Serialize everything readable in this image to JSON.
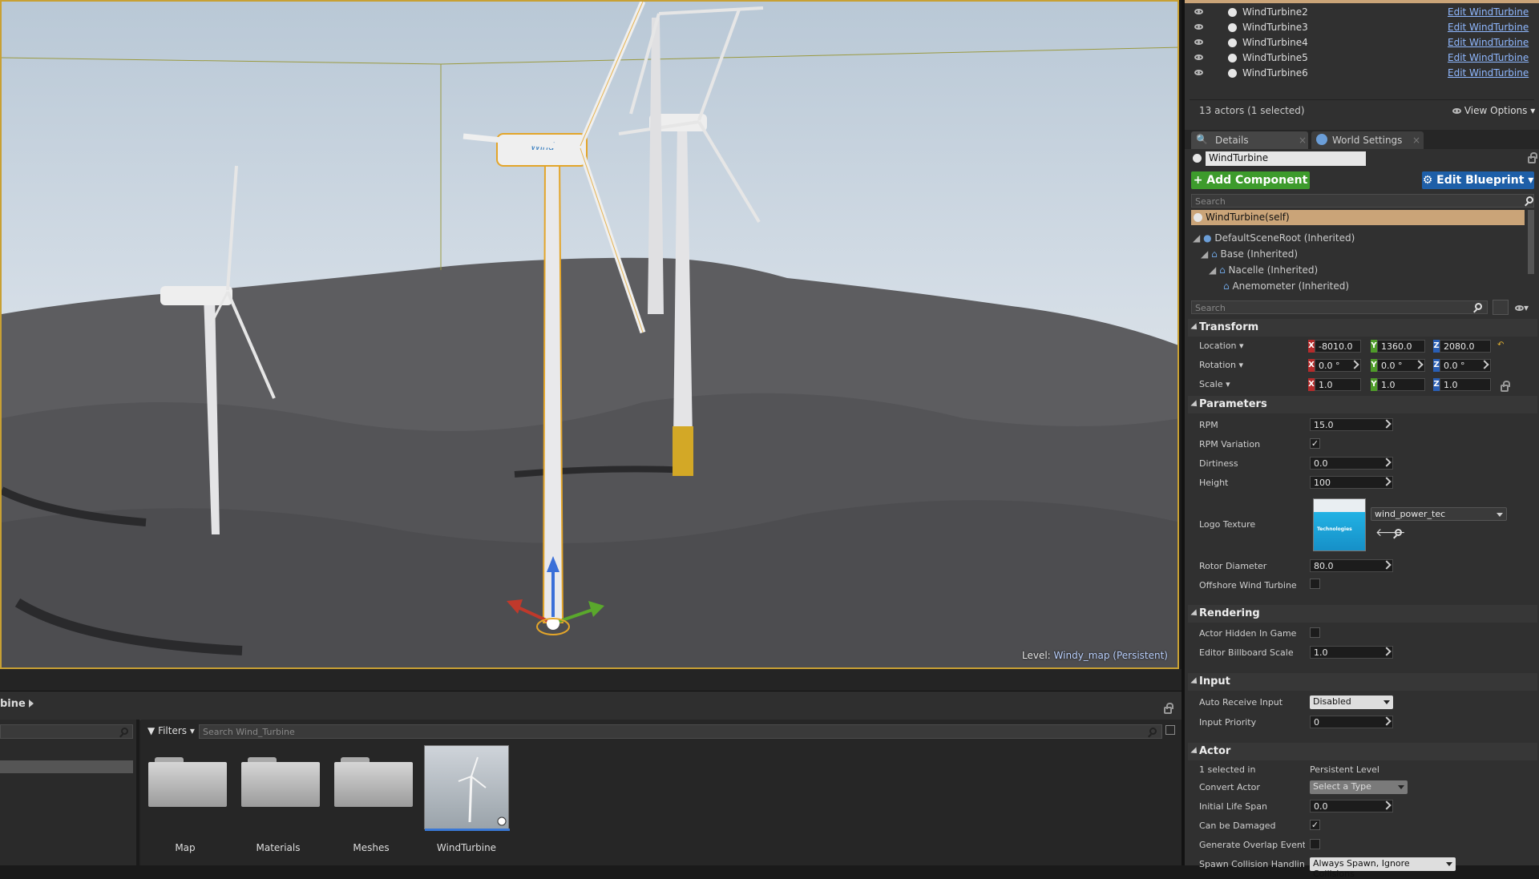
{
  "viewport": {
    "level_prefix": "Level:",
    "level_name": "Windy_map (Persistent)"
  },
  "content_browser": {
    "breadcrumb": "bine",
    "filters_label": "Filters",
    "search_placeholder": "Search Wind_Turbine",
    "assets": [
      {
        "label": "Map",
        "type": "folder"
      },
      {
        "label": "Materials",
        "type": "folder"
      },
      {
        "label": "Meshes",
        "type": "folder"
      },
      {
        "label": "WindTurbine",
        "type": "blueprint"
      }
    ]
  },
  "outliner": {
    "rows": [
      {
        "name": "WindTurbine2",
        "action": "Edit WindTurbine"
      },
      {
        "name": "WindTurbine3",
        "action": "Edit WindTurbine"
      },
      {
        "name": "WindTurbine4",
        "action": "Edit WindTurbine"
      },
      {
        "name": "WindTurbine5",
        "action": "Edit WindTurbine"
      },
      {
        "name": "WindTurbine6",
        "action": "Edit WindTurbine"
      }
    ],
    "actor_count": "13 actors (1 selected)",
    "view_options": "View Options"
  },
  "details": {
    "tabs": [
      "Details",
      "World Settings"
    ],
    "actor_name": "WindTurbine",
    "add_component": "+ Add Component",
    "edit_blueprint": "Edit Blueprint",
    "search_placeholder": "Search",
    "components": [
      "WindTurbine(self)",
      "DefaultSceneRoot (Inherited)",
      "Base (Inherited)",
      "Nacelle (Inherited)",
      "Anemometer (Inherited)"
    ],
    "search2_placeholder": "Search",
    "transform": {
      "title": "Transform",
      "location_label": "Location",
      "location": [
        "-8010.0",
        "1360.0",
        "2080.0"
      ],
      "rotation_label": "Rotation",
      "rotation": [
        "0.0 °",
        "0.0 °",
        "0.0 °"
      ],
      "scale_label": "Scale",
      "scale": [
        "1.0",
        "1.0",
        "1.0"
      ]
    },
    "parameters": {
      "title": "Parameters",
      "rpm_label": "RPM",
      "rpm": "15.0",
      "rpm_variation_label": "RPM Variation",
      "rpm_variation": true,
      "dirtiness_label": "Dirtiness",
      "dirtiness": "0.0",
      "height_label": "Height",
      "height": "100",
      "logo_texture_label": "Logo Texture",
      "logo_texture": "wind_power_tec",
      "logo_thumb_text": "Technologies",
      "rotor_diameter_label": "Rotor Diameter",
      "rotor_diameter": "80.0",
      "offshore_label": "Offshore Wind Turbine",
      "offshore": false
    },
    "rendering": {
      "title": "Rendering",
      "hidden_label": "Actor Hidden In Game",
      "hidden": false,
      "billboard_label": "Editor Billboard Scale",
      "billboard": "1.0"
    },
    "input": {
      "title": "Input",
      "auto_receive_label": "Auto Receive Input",
      "auto_receive": "Disabled",
      "priority_label": "Input Priority",
      "priority": "0"
    },
    "actor": {
      "title": "Actor",
      "selected_in_label": "1 selected in",
      "selected_in": "Persistent Level",
      "convert_label": "Convert Actor",
      "convert": "Select a Type",
      "life_span_label": "Initial Life Span",
      "life_span": "0.0",
      "damaged_label": "Can be Damaged",
      "damaged": true,
      "overlap_label": "Generate Overlap Events D",
      "overlap": false,
      "spawn_label": "Spawn Collision Handling M",
      "spawn": "Always Spawn, Ignore Collisions"
    }
  }
}
